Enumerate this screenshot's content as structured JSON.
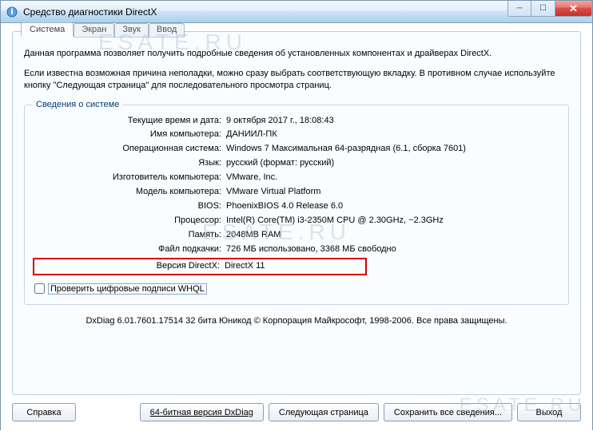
{
  "window": {
    "title": "Средство диагностики DirectX"
  },
  "tabs": [
    {
      "label": "Система",
      "active": true
    },
    {
      "label": "Экран",
      "active": false
    },
    {
      "label": "Звук",
      "active": false
    },
    {
      "label": "Ввод",
      "active": false
    }
  ],
  "intro": {
    "line1": "Данная программа позволяет получить подробные сведения об установленных компонентах и драйверах DirectX.",
    "line2": "Если известна возможная причина неполадки, можно сразу выбрать соответствующую вкладку. В противном случае используйте кнопку \"Следующая страница\" для последовательного просмотра страниц."
  },
  "group": {
    "title": "Сведения о системе",
    "rows": [
      {
        "label": "Текущие время и дата:",
        "value": "9 октября 2017 г., 18:08:43"
      },
      {
        "label": "Имя компьютера:",
        "value": "ДАНИИЛ-ПК"
      },
      {
        "label": "Операционная система:",
        "value": "Windows 7 Максимальная 64-разрядная (6.1, сборка 7601)"
      },
      {
        "label": "Язык:",
        "value": "русский (формат: русский)"
      },
      {
        "label": "Изготовитель компьютера:",
        "value": "VMware, Inc."
      },
      {
        "label": "Модель компьютера:",
        "value": "VMware Virtual Platform"
      },
      {
        "label": "BIOS:",
        "value": "PhoenixBIOS 4.0 Release 6.0"
      },
      {
        "label": "Процессор:",
        "value": "Intel(R) Core(TM) i3-2350M CPU @ 2.30GHz, ~2.3GHz"
      },
      {
        "label": "Память:",
        "value": "2048MB RAM"
      },
      {
        "label": "Файл подкачки:",
        "value": "726 МБ использовано, 3368 МБ свободно"
      },
      {
        "label": "Версия DirectX:",
        "value": "DirectX 11",
        "highlight": true
      }
    ]
  },
  "whql": {
    "label": "Проверить цифровые подписи WHQL"
  },
  "footer": "DxDiag 6.01.7601.17514 32 бита Юникод   © Корпорация Майкрософт, 1998-2006.  Все права защищены.",
  "buttons": {
    "help": "Справка",
    "bit64": "64-битная версия DxDiag",
    "next": "Следующая страница",
    "save": "Сохранить все сведения...",
    "exit": "Выход"
  },
  "watermark": "ESATE.RU"
}
